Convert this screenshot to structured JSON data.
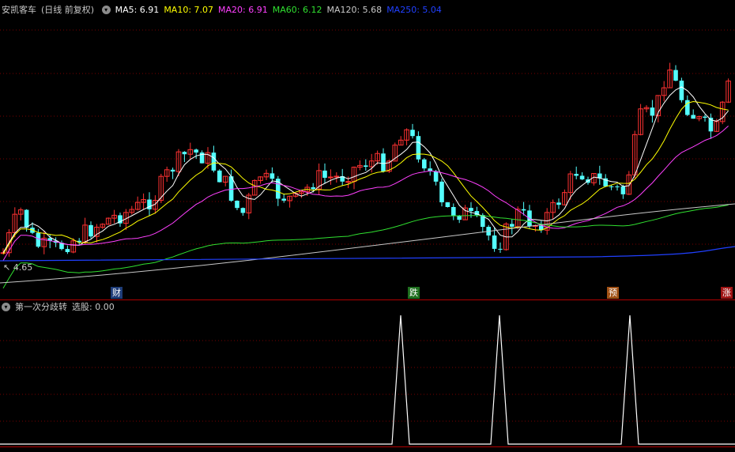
{
  "header": {
    "stock_name": "安凯客车",
    "period": "(日线 前复权)",
    "ma": [
      {
        "label": "MA5: 6.91",
        "color": "#ffffff"
      },
      {
        "label": "MA10: 7.07",
        "color": "#ffff00"
      },
      {
        "label": "MA20: 6.91",
        "color": "#ff40ff"
      },
      {
        "label": "MA60: 6.12",
        "color": "#30e030"
      },
      {
        "label": "MA120: 5.68",
        "color": "#c8c8c8"
      },
      {
        "label": "MA250: 5.04",
        "color": "#2040ff"
      }
    ]
  },
  "price_label": "4.65",
  "markers": [
    {
      "text": "财",
      "bg": "#1e3c78"
    },
    {
      "text": "跌",
      "bg": "#1e6e1e"
    },
    {
      "text": "预",
      "bg": "#a05014"
    },
    {
      "text": "涨",
      "bg": "#a01414"
    }
  ],
  "indicator": {
    "name": "第一次分歧转",
    "value_label": "选股: 0.00"
  },
  "colors": {
    "up": "#ff3232",
    "down": "#54ffff",
    "grid": "#780000",
    "signal": "#ffffff"
  }
}
